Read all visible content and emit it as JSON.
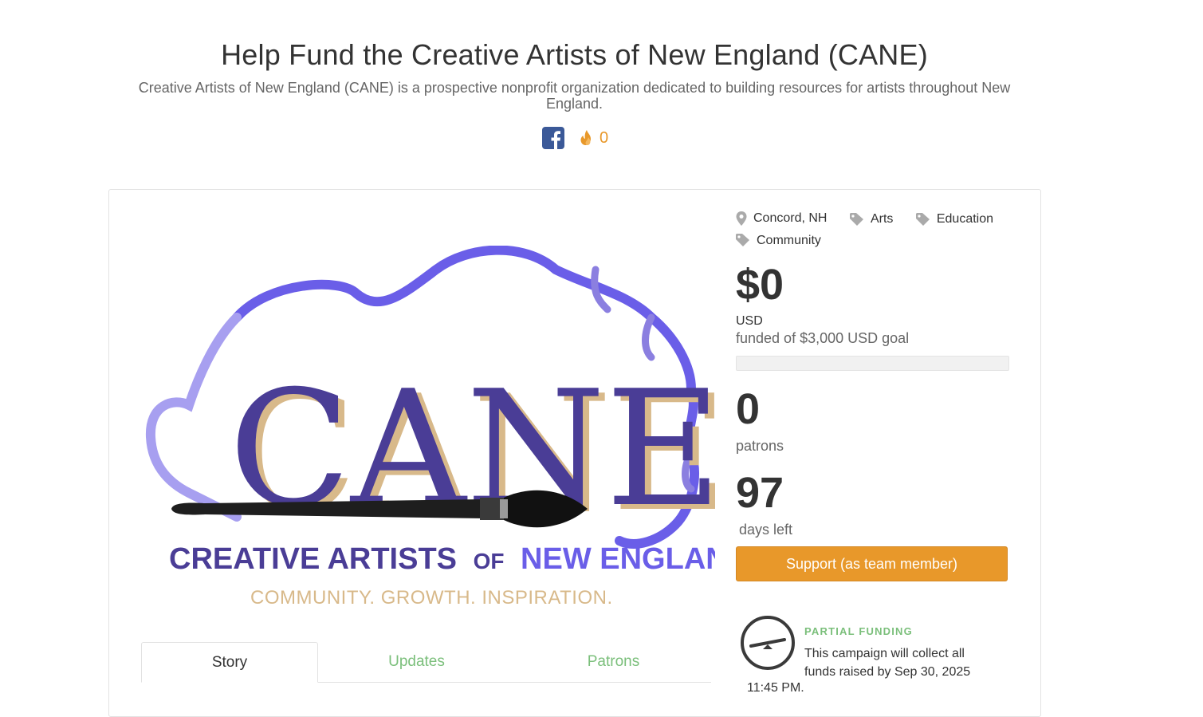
{
  "header": {
    "title": "Help Fund the Creative Artists of New England (CANE)",
    "subtitle": "Creative Artists of New England (CANE) is a prospective nonprofit organization dedicated to building resources for artists throughout New England.",
    "fire_count": "0"
  },
  "logo": {
    "letters": "CANE",
    "line1_a": "CREATIVE ARTISTS",
    "line1_b": "OF",
    "line1_c": "NEW ENGLAND",
    "tagline": "COMMUNITY. GROWTH. INSPIRATION.",
    "colors": {
      "purple": "#4a3d96",
      "lavender": "#8b7fe0",
      "tan": "#d8b98a",
      "blue": "#6a5ee8"
    }
  },
  "tabs": [
    {
      "label": "Story"
    },
    {
      "label": "Updates"
    },
    {
      "label": "Patrons"
    }
  ],
  "sidebar": {
    "location": "Concord, NH",
    "tags": [
      "Arts",
      "Education",
      "Community"
    ],
    "amount": "$0",
    "currency": "USD",
    "goal_text": "funded of $3,000 USD goal",
    "progress_fraction": 0,
    "patrons_count": "0",
    "patrons_label": "patrons",
    "days_count": "97",
    "days_label": "days left",
    "support_button": "Support (as team member)",
    "partial_title": "PARTIAL FUNDING",
    "partial_text": "This campaign will collect all funds raised by Sep 30, 2025",
    "partial_text2": "11:45 PM."
  },
  "colors": {
    "accent": "#e8982a",
    "green": "#7bbf7b",
    "facebook": "#3b5998"
  }
}
